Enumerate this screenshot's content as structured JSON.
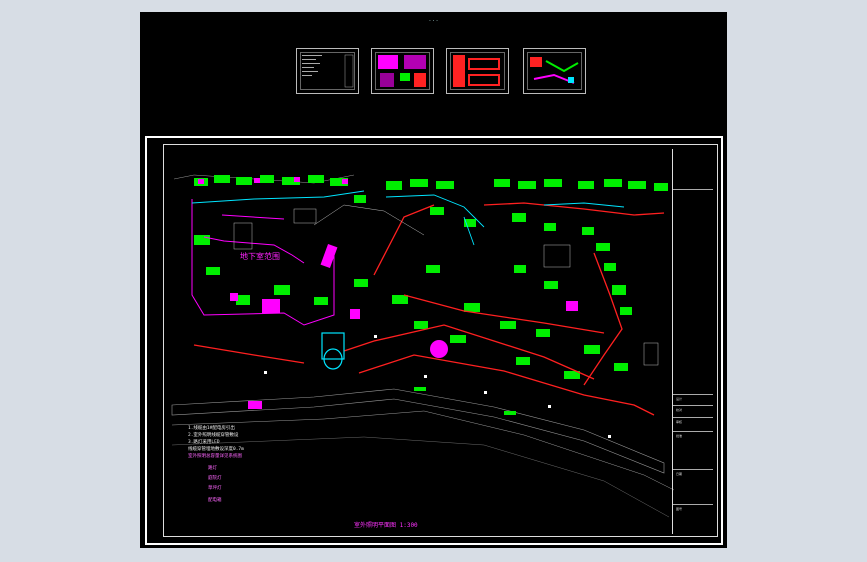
{
  "window": {
    "title": "...",
    "background": "#d7dde5",
    "canvas_color": "#000000"
  },
  "thumbnails": [
    {
      "name": "sheet-1",
      "style": "text"
    },
    {
      "name": "sheet-2",
      "style": "magenta"
    },
    {
      "name": "sheet-3",
      "style": "red"
    },
    {
      "name": "sheet-4",
      "style": "plan"
    }
  ],
  "drawing": {
    "underground_label": "地下室范围",
    "notes": [
      "1.线缆由1#配电房引出",
      "2.室外照明线缆穿管敷设",
      "3.路灯采用LED",
      "线缆穿管埋地敷设深度0.7m",
      "室外照明总容量详见系统图"
    ],
    "legend": [
      "路灯",
      "庭院灯",
      "草坪灯",
      "配电箱"
    ],
    "scale_title": "室外照明平面图 1:300",
    "title_block": [
      "设计",
      "校对",
      "审核",
      "批准",
      "日期",
      "图号"
    ]
  },
  "colors": {
    "building": "#00ee00",
    "cable": "#ff2020",
    "accent": "#ff00ff",
    "pipe": "#00e5ff",
    "road": "#9a9a9a"
  }
}
